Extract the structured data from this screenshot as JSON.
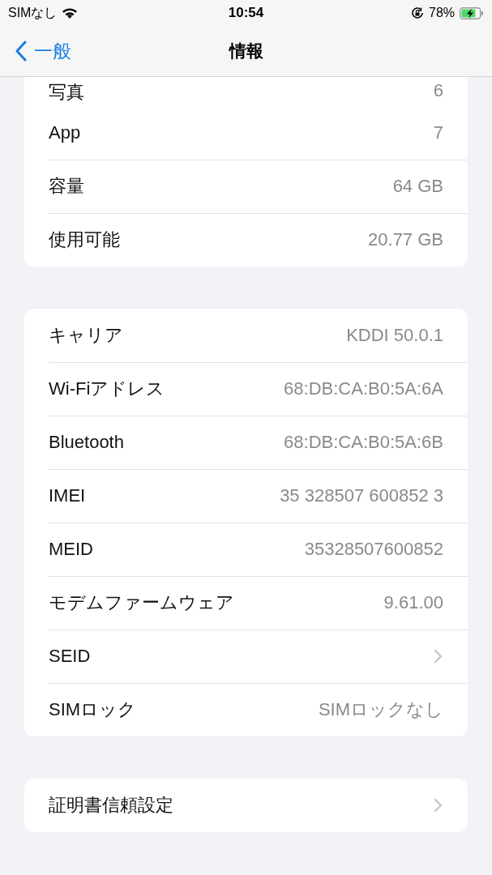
{
  "status_bar": {
    "carrier": "SIMなし",
    "time": "10:54",
    "battery": "78%"
  },
  "nav": {
    "back": "一般",
    "title": "情報"
  },
  "groups": [
    {
      "rows": [
        {
          "kind": "value",
          "label": "写真",
          "value": "6",
          "partial": true
        },
        {
          "kind": "value",
          "label": "App",
          "value": "7"
        },
        {
          "kind": "value",
          "label": "容量",
          "value": "64 GB"
        },
        {
          "kind": "value",
          "label": "使用可能",
          "value": "20.77 GB"
        }
      ]
    },
    {
      "rows": [
        {
          "kind": "value",
          "label": "キャリア",
          "value": "KDDI 50.0.1"
        },
        {
          "kind": "value",
          "label": "Wi-Fiアドレス",
          "value": "68:DB:CA:B0:5A:6A"
        },
        {
          "kind": "value",
          "label": "Bluetooth",
          "value": "68:DB:CA:B0:5A:6B"
        },
        {
          "kind": "value",
          "label": "IMEI",
          "value": "35 328507 600852 3"
        },
        {
          "kind": "value",
          "label": "MEID",
          "value": "35328507600852"
        },
        {
          "kind": "value",
          "label": "モデムファームウェア",
          "value": "9.61.00"
        },
        {
          "kind": "link",
          "label": "SEID"
        },
        {
          "kind": "value",
          "label": "SIMロック",
          "value": "SIMロックなし"
        }
      ]
    },
    {
      "rows": [
        {
          "kind": "link",
          "label": "証明書信頼設定"
        }
      ]
    }
  ]
}
